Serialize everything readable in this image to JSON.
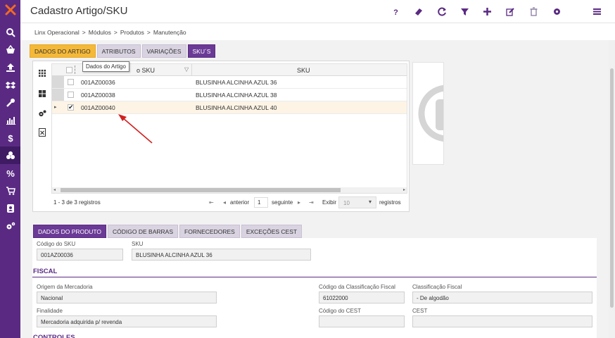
{
  "app": {
    "title": "Cadastro Artigo/SKU",
    "brand_color": "#5a2a83",
    "accent_color": "#f5b938"
  },
  "sidebar": {
    "items": [
      {
        "icon": "search-icon"
      },
      {
        "icon": "basket-icon"
      },
      {
        "icon": "upload-icon"
      },
      {
        "icon": "dropbox-icon"
      },
      {
        "icon": "wrench-icon"
      },
      {
        "icon": "bar-chart-icon"
      },
      {
        "icon": "dollar-icon"
      },
      {
        "icon": "boxes-icon"
      },
      {
        "icon": "percent-icon"
      },
      {
        "icon": "cart-icon"
      },
      {
        "icon": "contacts-icon"
      },
      {
        "icon": "gears-icon"
      }
    ]
  },
  "toolbar": {
    "icons": [
      "help-icon",
      "eraser-icon",
      "refresh-icon",
      "filter-icon",
      "add-icon",
      "edit-icon",
      "delete-icon",
      "settings-icon",
      "menu-icon"
    ]
  },
  "breadcrumb": {
    "items": [
      "Linx Operacional",
      "Módulos",
      "Produtos",
      "Manutenção"
    ],
    "separator": ">"
  },
  "top_tabs": [
    {
      "label": "DADOS DO ARTIGO",
      "state": "active"
    },
    {
      "label": "ATRIBUTOS",
      "state": "normal"
    },
    {
      "label": "VARIAÇÕES",
      "state": "normal"
    },
    {
      "label": "SKU´S",
      "state": "selected"
    }
  ],
  "grid": {
    "tooltip": "Dados do Artigo",
    "columns": [
      "o SKU",
      "SKU"
    ],
    "rows": [
      {
        "code": "001AZ00036",
        "sku": "BLUSINHA ALCINHA AZUL 36",
        "checked": false,
        "selected": false
      },
      {
        "code": "001AZ00038",
        "sku": "BLUSINHA ALCINHA AZUL 38",
        "checked": false,
        "selected": false
      },
      {
        "code": "001AZ00040",
        "sku": "BLUSINHA ALCINHA AZUL 40",
        "checked": true,
        "selected": true
      }
    ],
    "pager": {
      "summary": "1 - 3 de 3 registros",
      "previous": "anterior",
      "page": "1",
      "next": "seguinte",
      "show_label": "Exibir",
      "page_size": "10",
      "records_label": "registros"
    }
  },
  "bottom_tabs": [
    {
      "label": "DADOS DO PRODUTO",
      "state": "selected"
    },
    {
      "label": "CÓDIGO DE BARRAS",
      "state": "normal"
    },
    {
      "label": "FORNECEDORES",
      "state": "normal"
    },
    {
      "label": "EXCEÇÕES CEST",
      "state": "normal"
    }
  ],
  "product": {
    "sku_code_label": "Código do SKU",
    "sku_code": "001AZ00036",
    "sku_label": "SKU",
    "sku": "BLUSINHA ALCINHA AZUL 36"
  },
  "fiscal": {
    "title": "FISCAL",
    "origem_label": "Origem da Mercadoria",
    "origem": "Nacional",
    "class_code_label": "Código da Classificação Fiscal",
    "class_code": "61022000",
    "class_label": "Classificação Fiscal",
    "class": "- De algodão",
    "finalidade_label": "Finalidade",
    "finalidade": "Mercadoria adquirida p/ revenda",
    "cest_code_label": "Código do CEST",
    "cest_code": "",
    "cest_label": "CEST",
    "cest": ""
  },
  "controles": {
    "title": "CONTROLES"
  }
}
